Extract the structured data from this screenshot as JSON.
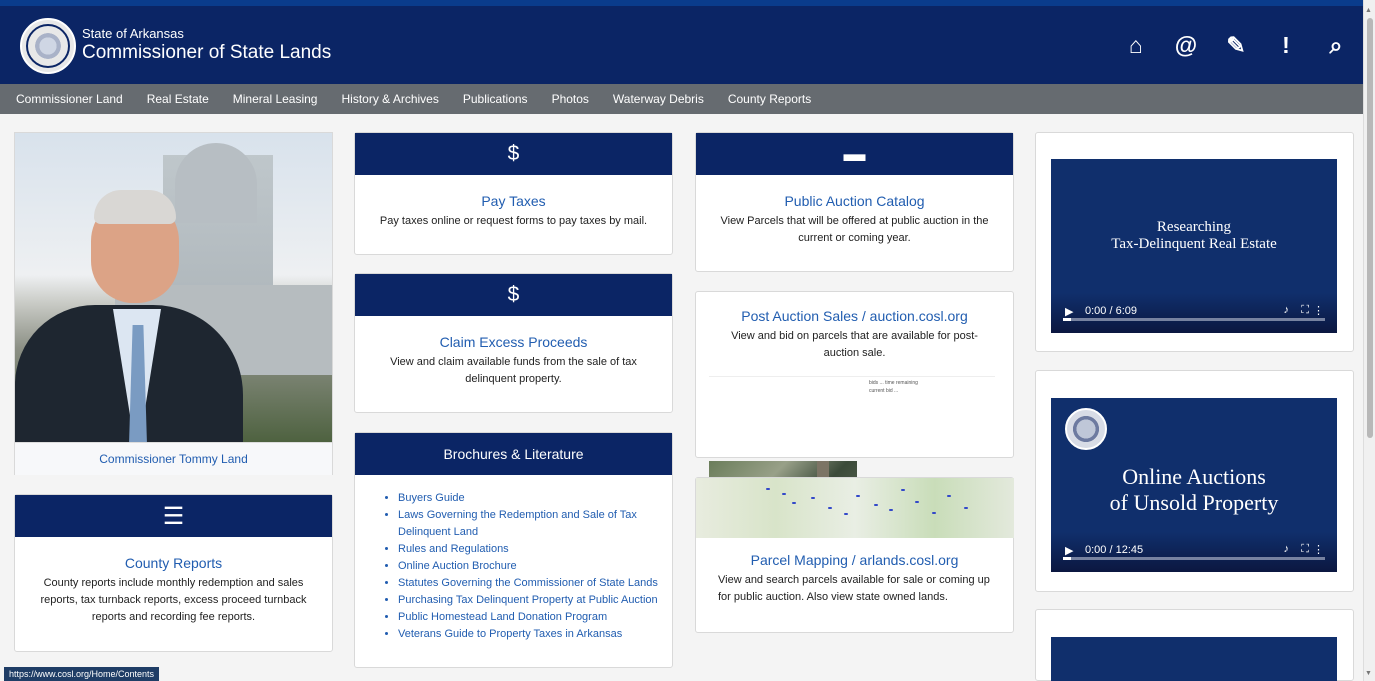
{
  "header": {
    "state": "State of Arkansas",
    "agency": "Commissioner of State Lands",
    "icons": [
      "home-icon",
      "email-icon",
      "edit-icon",
      "alert-icon",
      "search-icon"
    ]
  },
  "nav": {
    "items": [
      "Commissioner Land",
      "Real Estate",
      "Mineral Leasing",
      "History & Archives",
      "Publications",
      "Photos",
      "Waterway Debris",
      "County Reports"
    ]
  },
  "profile": {
    "caption": "Commissioner Tommy Land"
  },
  "county_reports": {
    "title": "County Reports",
    "text": "County reports include monthly redemption and sales reports, tax turnback reports, excess proceed turnback reports and recording fee reports."
  },
  "pay_taxes": {
    "title": "Pay Taxes",
    "text": "Pay taxes online or request forms to pay taxes by mail."
  },
  "claim_excess": {
    "title": "Claim Excess Proceeds",
    "text": "View and claim available funds from the sale of tax delinquent property."
  },
  "brochures": {
    "title": "Brochures & Literature",
    "items": [
      "Buyers Guide",
      "Laws Governing the Redemption and Sale of Tax Delinquent Land",
      "Rules and Regulations",
      "Online Auction Brochure",
      "Statutes Governing the Commissioner of State Lands",
      "Purchasing Tax Delinquent Property at Public Auction",
      "Public Homestead Land Donation Program",
      "Veterans Guide to Property Taxes in Arkansas"
    ]
  },
  "auction_catalog": {
    "title": "Public Auction Catalog",
    "text": "View Parcels that will be offered at public auction in the current or coming year."
  },
  "post_auction": {
    "title": "Post Auction Sales / auction.cosl.org",
    "text": "View and bid on parcels that are available for post-auction sale."
  },
  "parcel_mapping": {
    "title": "Parcel Mapping / arlands.cosl.org",
    "text": "View and search parcels available for sale or coming up for public auction. Also view state owned lands."
  },
  "videos": [
    {
      "title_line1": "Researching",
      "title_line2": "Tax-Delinquent Real Estate",
      "time": "0:00 / 6:09"
    },
    {
      "title_line1": "Online Auctions",
      "title_line2": "of Unsold Property",
      "time": "0:00 / 12:45"
    }
  ],
  "status_url": "https://www.cosl.org/Home/Contents",
  "colors": {
    "primary_navy": "#0b2565",
    "link_blue": "#215db0",
    "nav_gray": "#666b70"
  }
}
